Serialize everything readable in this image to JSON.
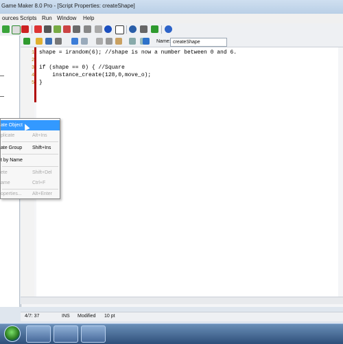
{
  "window": {
    "title": "Game Maker 8.0 Pro - [Script Properties: createShape]"
  },
  "menubar": {
    "items": [
      "ources",
      "Scripts",
      "Run",
      "Window",
      "Help"
    ]
  },
  "toolbar": {
    "icons": [
      "play-icon",
      "debug-play-icon",
      "create-sprite-icon",
      "create-sound-icon",
      "create-background-icon",
      "create-path-icon",
      "create-script-icon",
      "create-font-icon",
      "create-timeline-icon",
      "create-object-icon",
      "create-room-icon",
      "game-information-icon",
      "global-settings-icon",
      "extension-packages-icon",
      "help-icon"
    ]
  },
  "script": {
    "toolbar_icons": [
      "ok-check-icon",
      "open-icon",
      "save-icon",
      "print-icon",
      "undo-icon",
      "redo-icon",
      "cut-icon",
      "copy-icon",
      "paste-icon",
      "find-icon",
      "find-replace-icon",
      "syntax-check-icon"
    ],
    "name_label": "Name:",
    "name_value": "createShape",
    "lines": [
      {
        "num": "1",
        "text": "shape = irandom(6); //shape is now a number between 0 and 6."
      },
      {
        "num": "2",
        "text": ""
      },
      {
        "num": "3",
        "text": "if (shape == 0) { //Square"
      },
      {
        "num": "4",
        "text": "    instance_create(128,0,move_o);"
      },
      {
        "num": "5",
        "text": "}"
      }
    ]
  },
  "status": {
    "position": "4/7: 37",
    "mode": "INS",
    "state": "Modified",
    "font": "10 pt"
  },
  "context_menu": {
    "items": [
      {
        "label": "ate Object",
        "shortcut": "",
        "highlighted": true,
        "disabled": false
      },
      {
        "label": "plicate",
        "shortcut": "Alt+Ins",
        "highlighted": false,
        "disabled": true
      },
      {
        "label": "ate Group",
        "shortcut": "Shift+Ins",
        "highlighted": false,
        "disabled": false
      },
      {
        "label": "t by Name",
        "shortcut": "",
        "highlighted": false,
        "disabled": false
      },
      {
        "label": "ete",
        "shortcut": "Shift+Del",
        "highlighted": false,
        "disabled": true
      },
      {
        "label": "ame",
        "shortcut": "Ctrl+F",
        "highlighted": false,
        "disabled": true
      },
      {
        "label": "operties...",
        "shortcut": "Alt+Enter",
        "highlighted": false,
        "disabled": true
      }
    ]
  },
  "taskbar": {
    "items": [
      "start-orb",
      "game-maker-task",
      "game-maker-pro-task",
      "loading-task"
    ]
  }
}
